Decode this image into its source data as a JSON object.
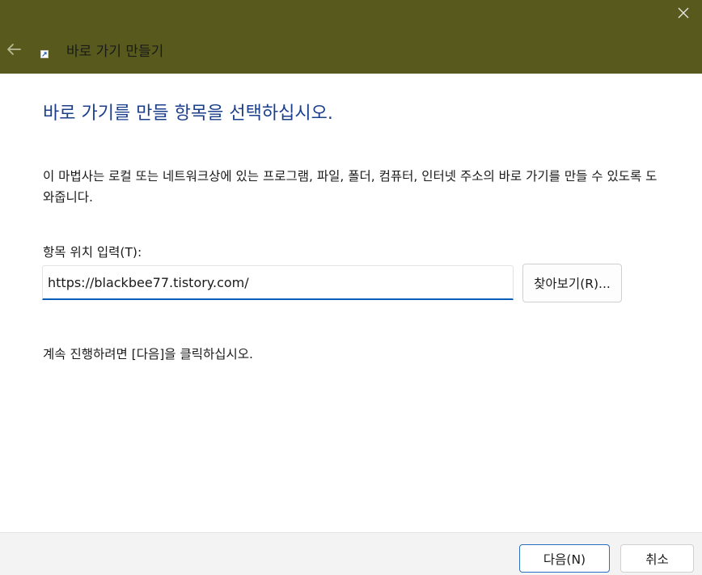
{
  "window": {
    "title": "바로 가기 만들기",
    "titlebar_color": "#575a1c",
    "back_icon": "arrow-left-icon",
    "close_icon": "close-icon",
    "app_icon": "shortcut-icon"
  },
  "main": {
    "heading": "바로 가기를 만들 항목을 선택하십시오.",
    "heading_color": "#1b3f8b",
    "description": "이 마법사는 로컬 또는 네트워크상에 있는 프로그램, 파일, 폴더, 컴퓨터, 인터넷 주소의 바로 가기를 만들 수 있도록 도와줍니다.",
    "location_label": "항목 위치 입력(T):",
    "location_value": "https://blackbee77.tistory.com/",
    "browse_label": "찾아보기(R)...",
    "instruction": "계속 진행하려면 [다음]을 클릭하십시오."
  },
  "footer": {
    "next_label": "다음(N)",
    "cancel_label": "취소"
  }
}
